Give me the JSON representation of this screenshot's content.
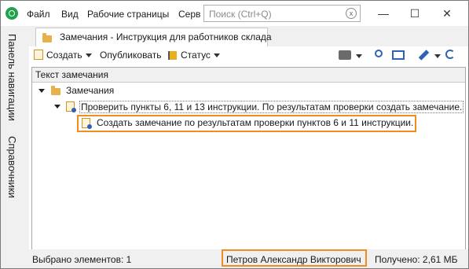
{
  "window": {
    "menu": [
      "Файл",
      "Вид",
      "Рабочие страницы",
      "Серв"
    ],
    "search_placeholder": "Поиск (Ctrl+Q)",
    "search_clear": "x",
    "controls": {
      "minimize": "—",
      "maximize": "☐",
      "close": "✕"
    }
  },
  "nav_panel": {
    "items": [
      "Панель навигации",
      "Справочники"
    ]
  },
  "tab": {
    "title": "Замечания - Инструкция для работников склада"
  },
  "toolbar": {
    "create": "Создать",
    "publish": "Опубликовать",
    "status": "Статус",
    "icons": [
      "printer-icon",
      "search-icon",
      "view-icon",
      "wrench-icon",
      "refresh-icon"
    ]
  },
  "table": {
    "column_header": "Текст замечания",
    "rows": [
      {
        "level": 0,
        "text": "Замечания",
        "icon": "folder-icon"
      },
      {
        "level": 1,
        "text": "Проверить пункты 6, 11 и 13 инструкции. По результатам проверки создать замечание.",
        "icon": "remark-icon"
      },
      {
        "level": 2,
        "text": "Создать замечание по результатам проверки пунктов 6 и 11 инструкции.",
        "icon": "remark-icon",
        "highlighted": true
      }
    ]
  },
  "status_bar": {
    "selected": "Выбрано элементов: 1",
    "user": "Петров Александр Викторович",
    "received": "Получено: 2,61 МБ"
  },
  "colors": {
    "highlight": "#f28c1d",
    "app_icon": "#1fa34a"
  }
}
